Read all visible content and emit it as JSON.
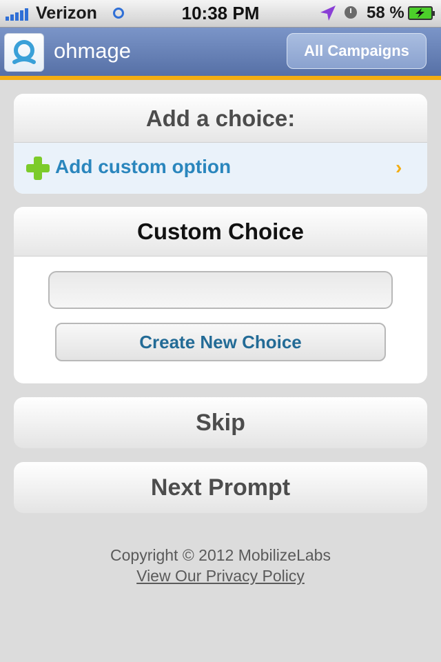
{
  "status_bar": {
    "carrier": "Verizon",
    "time": "10:38 PM",
    "battery_percent": "58 %",
    "signal_bars": 5,
    "icons": [
      "signal-icon",
      "activity-icon",
      "location-icon",
      "alarm-clock-icon",
      "battery-charging-icon"
    ]
  },
  "nav": {
    "app_title": "ohmage",
    "all_campaigns_label": "All Campaigns",
    "logo_icon": "ohmage-logo-icon"
  },
  "add_choice": {
    "header": "Add a choice:",
    "option_label": "Add custom option",
    "option_icon": "plus-icon",
    "chevron_icon": "chevron-right-icon"
  },
  "custom_choice": {
    "header": "Custom Choice",
    "input_value": "",
    "create_label": "Create New Choice"
  },
  "actions": {
    "skip_label": "Skip",
    "next_label": "Next Prompt"
  },
  "footer": {
    "copyright": "Copyright © 2012 MobilizeLabs",
    "privacy_link": "View Our Privacy Policy"
  },
  "colors": {
    "nav_top": "#7b95c8",
    "nav_bottom": "#5670a6",
    "accent": "#f3ad12",
    "link_blue": "#2a86bd",
    "plus_green": "#7ccb2a"
  }
}
